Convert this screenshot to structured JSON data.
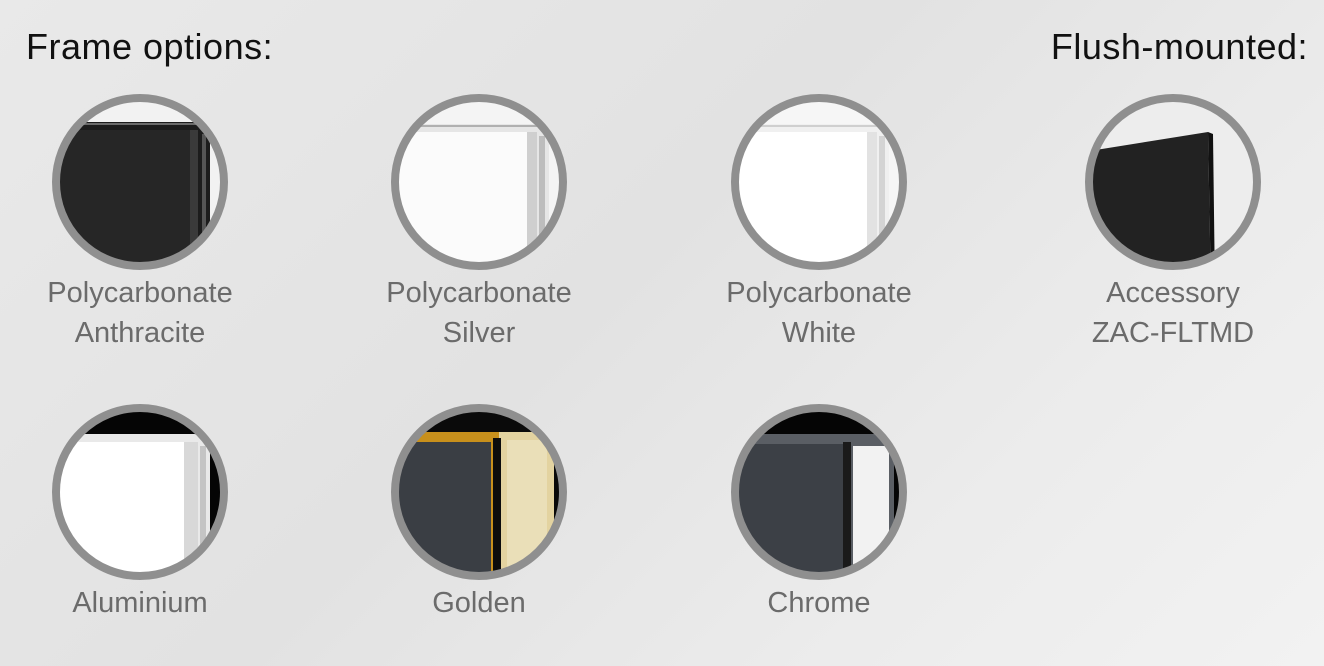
{
  "headings": {
    "frame_options": "Frame options:",
    "flush_mounted": "Flush-mounted:"
  },
  "options": [
    {
      "line1": "Polycarbonate",
      "line2": "Anthracite",
      "icon": "anthracite-frame-icon"
    },
    {
      "line1": "Polycarbonate",
      "line2": "Silver",
      "icon": "silver-frame-icon"
    },
    {
      "line1": "Polycarbonate",
      "line2": "White",
      "icon": "white-frame-icon"
    },
    {
      "line1": "Accessory",
      "line2": "ZAC-FLTMD",
      "icon": "flush-mount-icon"
    },
    {
      "line1": "Aluminium",
      "line2": "",
      "icon": "aluminium-frame-icon"
    },
    {
      "line1": "Golden",
      "line2": "",
      "icon": "golden-frame-icon"
    },
    {
      "line1": "Chrome",
      "line2": "",
      "icon": "chrome-frame-icon"
    }
  ],
  "colors": {
    "ring": "#8f8f8f",
    "label": "#6b6b6b",
    "heading": "#111111"
  }
}
